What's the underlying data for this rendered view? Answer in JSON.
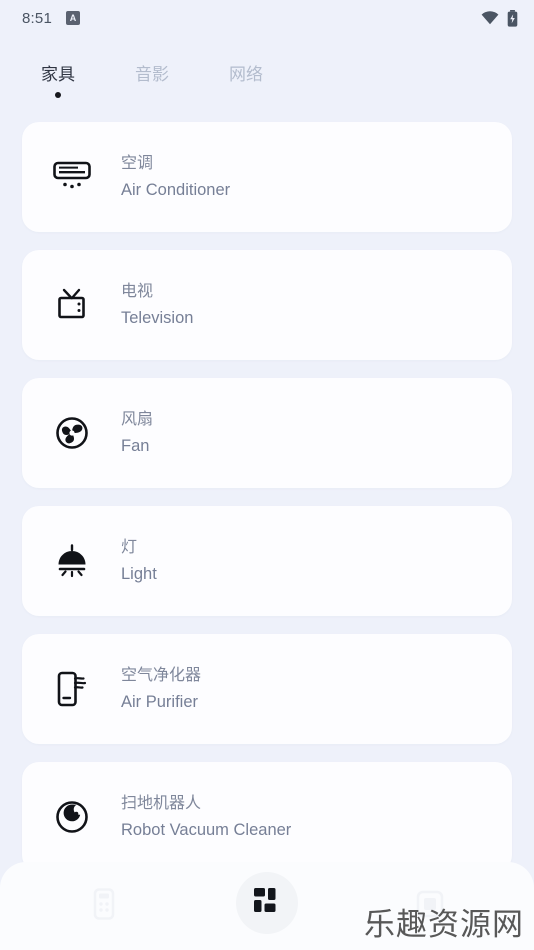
{
  "status_bar": {
    "time": "8:51",
    "app_badge_letter": "A",
    "icons": [
      "wifi-icon",
      "battery-charging-icon"
    ]
  },
  "tabs": [
    {
      "label": "家具",
      "active": true
    },
    {
      "label": "音影",
      "active": false
    },
    {
      "label": "网络",
      "active": false
    }
  ],
  "devices": [
    {
      "name_cn": "空调",
      "name_en": "Air Conditioner",
      "icon": "air-conditioner-icon"
    },
    {
      "name_cn": "电视",
      "name_en": "Television",
      "icon": "television-icon"
    },
    {
      "name_cn": "风扇",
      "name_en": "Fan",
      "icon": "fan-icon"
    },
    {
      "name_cn": "灯",
      "name_en": "Light",
      "icon": "ceiling-light-icon"
    },
    {
      "name_cn": "空气净化器",
      "name_en": "Air Purifier",
      "icon": "air-purifier-icon"
    },
    {
      "name_cn": "扫地机器人",
      "name_en": "Robot Vacuum Cleaner",
      "icon": "robot-vacuum-icon"
    }
  ],
  "bottom_nav": [
    {
      "name": "remote-control-icon",
      "active": false
    },
    {
      "name": "grid-dashboard-icon",
      "active": true
    },
    {
      "name": "scan-frame-icon",
      "active": false
    }
  ],
  "watermark": {
    "text": "乐趣资源网"
  },
  "colors": {
    "background": "#eef1fa",
    "card": "#fdfdff",
    "text_primary": "#2f3542",
    "text_muted": "#7f879b",
    "tab_inactive": "#b3bccd",
    "icon_dark": "#111318"
  }
}
